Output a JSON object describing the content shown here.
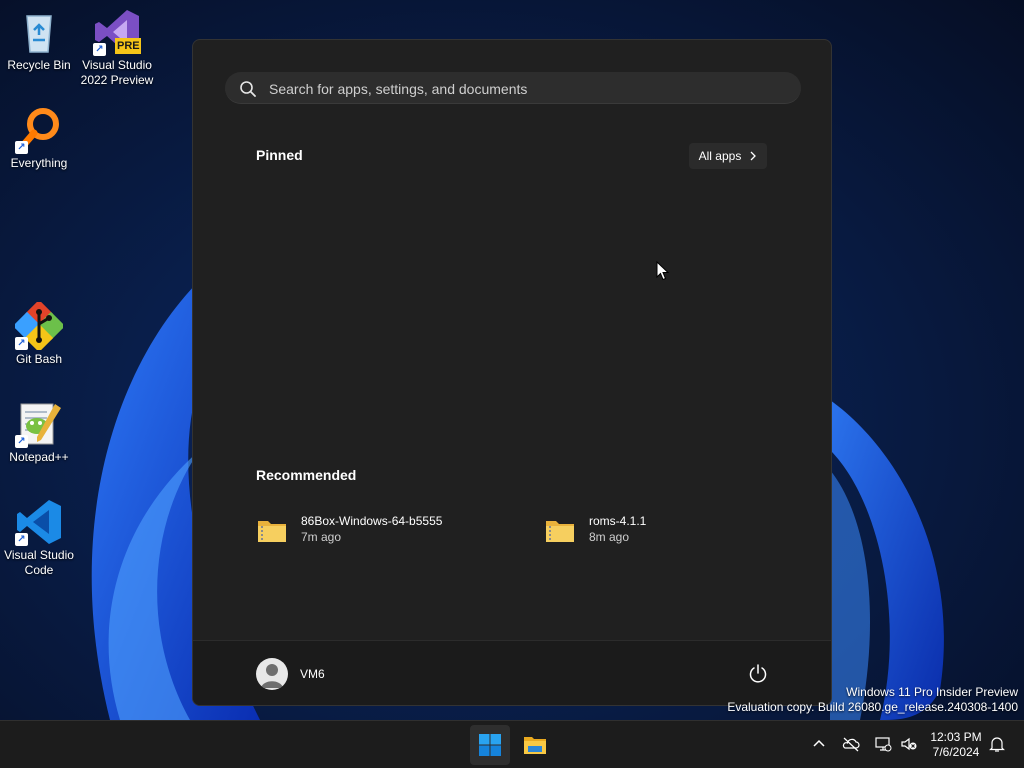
{
  "desktop": {
    "icons": [
      {
        "label": "Recycle Bin",
        "icon": "recycle-bin-icon"
      },
      {
        "label": "Visual Studio\n2022 Preview",
        "icon": "visual-studio-preview-icon",
        "badge": "PRE"
      },
      {
        "label": "Everything",
        "icon": "everything-search-icon"
      },
      {
        "label": "Git Bash",
        "icon": "git-bash-icon"
      },
      {
        "label": "Notepad++",
        "icon": "notepad-plus-plus-icon"
      },
      {
        "label": "Visual Studio\nCode",
        "icon": "vscode-icon"
      }
    ]
  },
  "start_menu": {
    "search_placeholder": "Search for apps, settings, and documents",
    "pinned_title": "Pinned",
    "all_apps_label": "All apps",
    "recommended_title": "Recommended",
    "recommended": [
      {
        "name": "86Box-Windows-64-b5555",
        "time": "7m ago",
        "icon": "zip-folder-icon"
      },
      {
        "name": "roms-4.1.1",
        "time": "8m ago",
        "icon": "zip-folder-icon"
      }
    ],
    "user_name": "VM6"
  },
  "watermark": {
    "line1": "Windows 11 Pro Insider Preview",
    "line2": "Evaluation copy. Build 26080.ge_release.240308-1400"
  },
  "taskbar": {
    "time": "12:03 PM",
    "date": "7/6/2024"
  },
  "colors": {
    "start_bg": "#202020",
    "taskbar_bg": "#1c1c1c",
    "accent": "#0078d4",
    "folder": "#f0c24b"
  }
}
